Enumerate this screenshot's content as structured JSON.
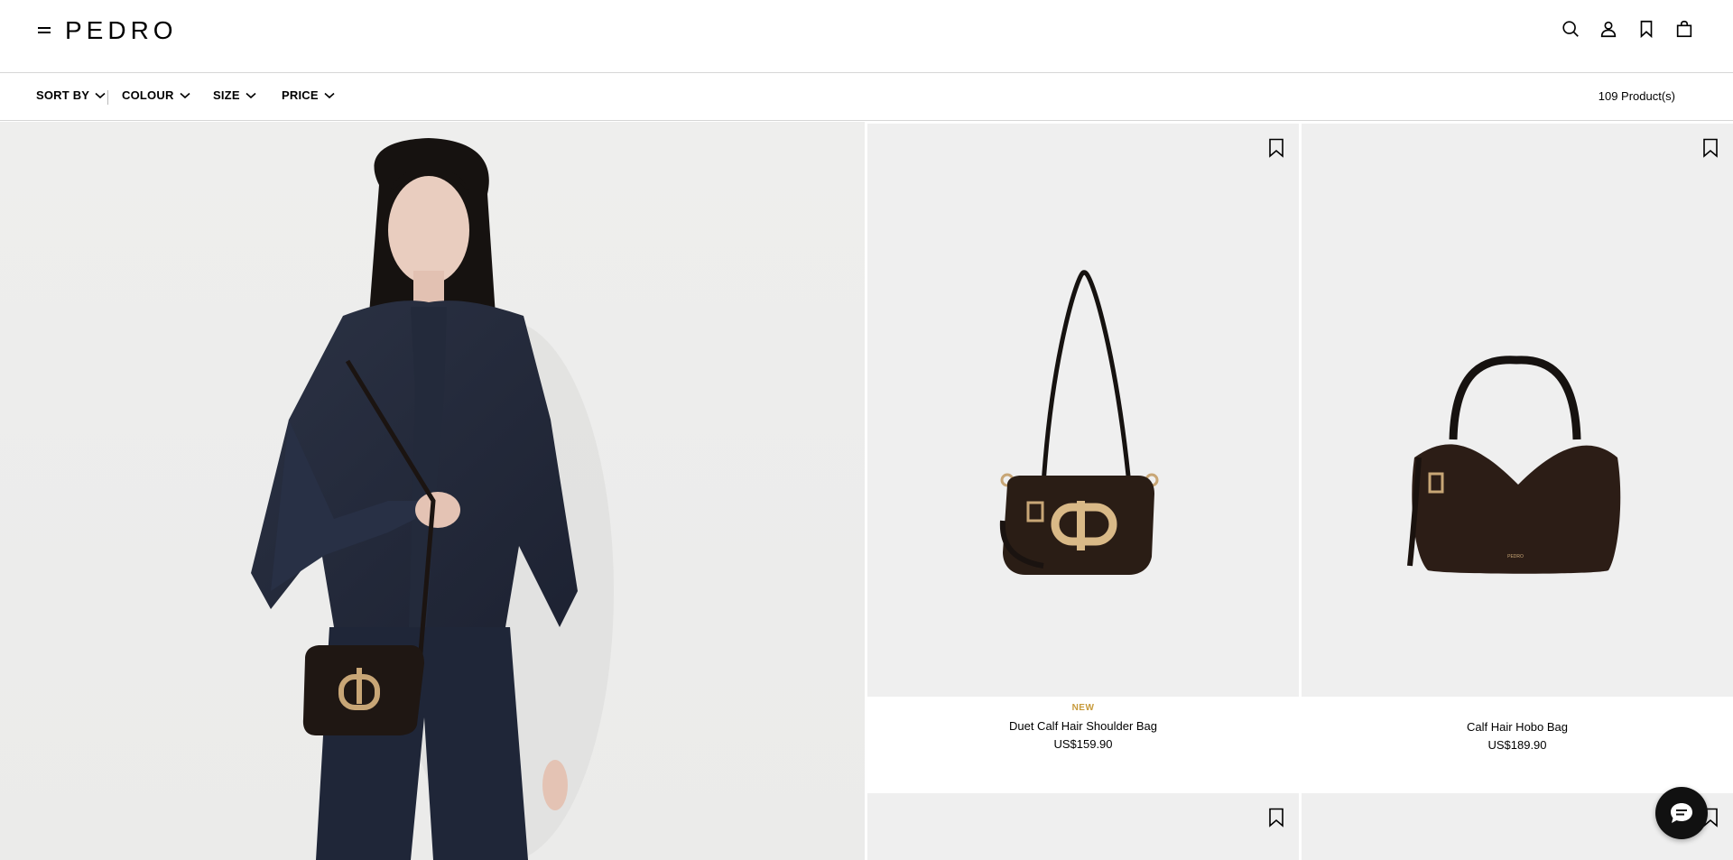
{
  "header": {
    "logo": "PEDRO",
    "icons": [
      "menu-icon",
      "search-icon",
      "user-icon",
      "bookmark-icon",
      "shopping-bag-icon"
    ]
  },
  "filters": {
    "sort_by": "SORT BY",
    "colour": "COLOUR",
    "size": "SIZE",
    "price": "PRICE",
    "product_count": "109 Product(s)"
  },
  "products": [
    {
      "badge": "NEW",
      "name": "Duet Calf Hair Shoulder Bag",
      "price": "US$159.90"
    },
    {
      "badge": "",
      "name": "Calf Hair Hobo Bag",
      "price": "US$189.90"
    }
  ],
  "colors": {
    "accent_badge": "#c79a3b",
    "image_bg": "#efefef"
  }
}
